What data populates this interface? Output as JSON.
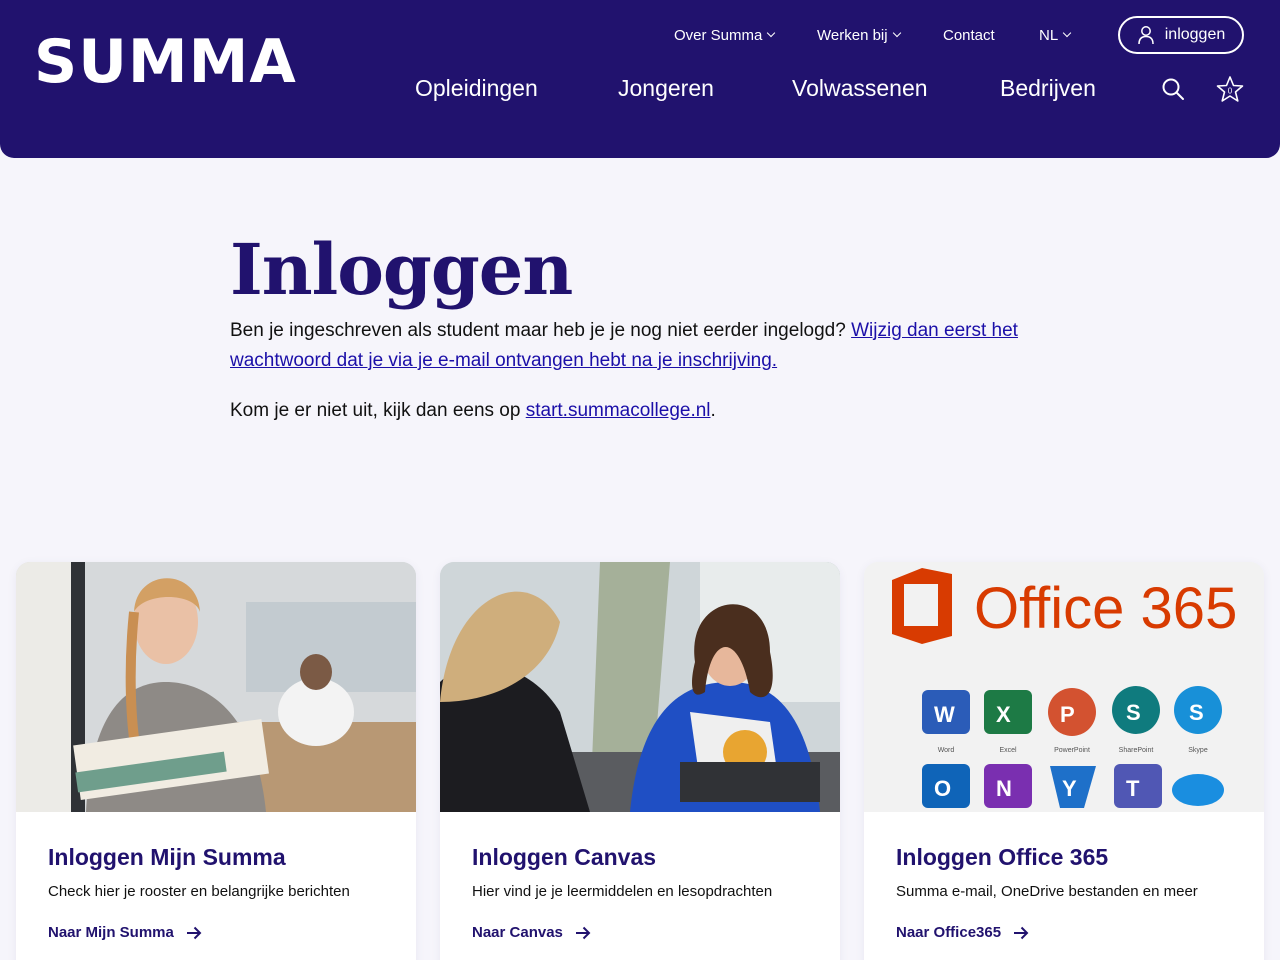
{
  "brand": {
    "logo_text": "SUMMA"
  },
  "topnav": {
    "items": [
      {
        "label": "Over Summa",
        "dropdown": true
      },
      {
        "label": "Werken bij",
        "dropdown": true
      },
      {
        "label": "Contact",
        "dropdown": false
      },
      {
        "label": "NL",
        "dropdown": true
      }
    ],
    "login_label": "inloggen"
  },
  "mainnav": {
    "items": [
      "Opleidingen",
      "Jongeren",
      "Volwassenen",
      "Bedrijven"
    ],
    "favorites_count": "0"
  },
  "content": {
    "title": "Inloggen",
    "para1_text": "Ben je ingeschreven als student maar heb je je nog niet eerder ingelogd? ",
    "para1_link": "Wijzig dan eerst het wachtwoord dat je via je e-mail ontvangen hebt na je inschrijving.",
    "para2_text": "Kom je er niet uit, kijk dan eens op ",
    "para2_link": "start.summacollege.nl",
    "para2_end": "."
  },
  "cards": [
    {
      "title": "Inloggen Mijn Summa",
      "desc": "Check hier je rooster en belangrijke berichten",
      "link": "Naar Mijn Summa"
    },
    {
      "title": "Inloggen Canvas",
      "desc": "Hier vind je je leermiddelen en lesopdrachten",
      "link": "Naar Canvas"
    },
    {
      "title": "Inloggen Office 365",
      "desc": "Summa e-mail, OneDrive bestanden en meer",
      "link": "Naar Office365"
    }
  ],
  "office_image": {
    "heading": "Office 365",
    "apps": [
      "Word",
      "Excel",
      "PowerPoint",
      "SharePoint",
      "Skype"
    ],
    "icon_letters": [
      "W",
      "X",
      "P",
      "S",
      "S",
      "O",
      "N",
      "Y",
      "T",
      ""
    ]
  },
  "colors": {
    "header": "#21126e",
    "accent_link": "#1b0fa8",
    "office_orange": "#d83b01"
  }
}
